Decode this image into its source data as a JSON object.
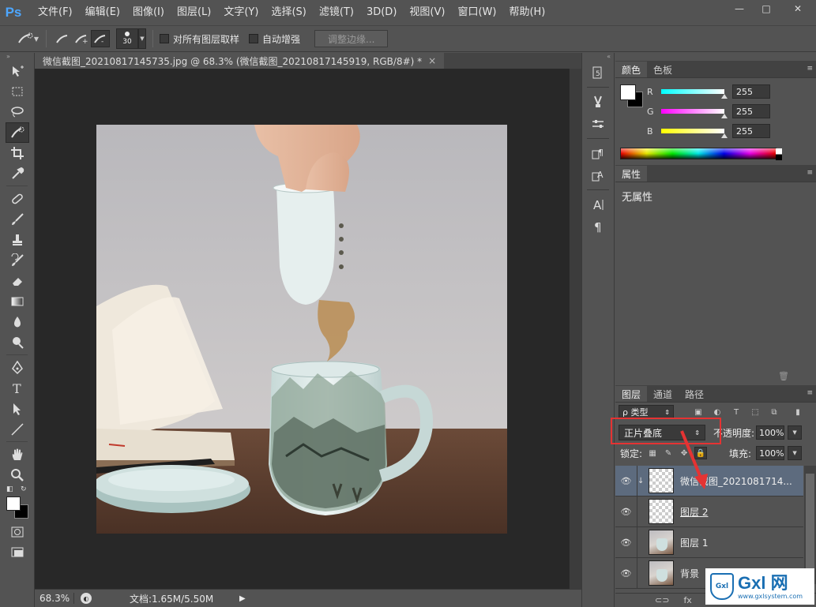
{
  "app": {
    "logo": "Ps"
  },
  "menu": [
    "文件(F)",
    "编辑(E)",
    "图像(I)",
    "图层(L)",
    "文字(Y)",
    "选择(S)",
    "滤镜(T)",
    "3D(D)",
    "视图(V)",
    "窗口(W)",
    "帮助(H)"
  ],
  "window_controls": {
    "minimize": "—",
    "maximize": "□",
    "close": "✕"
  },
  "options": {
    "brush_size": "30",
    "sample_all_layers": "对所有图层取样",
    "auto_enhance": "自动增强",
    "refine_edge": "调整边缘..."
  },
  "document": {
    "tab_title": "微信截图_20210817145735.jpg @ 68.3% (微信截图_20210817145919, RGB/8#) *",
    "close": "×",
    "zoom": "68.3%",
    "doc_info": "文档:1.65M/5.50M"
  },
  "color_panel": {
    "tabs": [
      "颜色",
      "色板"
    ],
    "channels": [
      {
        "label": "R",
        "value": "255",
        "color": "#00ffff"
      },
      {
        "label": "G",
        "value": "255",
        "color": "#ff00ff"
      },
      {
        "label": "B",
        "value": "255",
        "color": "#ffff00"
      }
    ]
  },
  "properties_panel": {
    "tabs": [
      "属性"
    ],
    "text": "无属性"
  },
  "layers_panel": {
    "tabs": [
      "图层",
      "通道",
      "路径"
    ],
    "kind_label": "ρ 类型",
    "blend_mode": "正片叠底",
    "opacity_label": "不透明度:",
    "opacity_value": "100%",
    "lock_label": "锁定:",
    "fill_label": "填充:",
    "fill_value": "100%",
    "layers": [
      {
        "name": "微信截图_2021081714...",
        "selected": true,
        "clipped": true,
        "thumb": "transparent",
        "underline": false
      },
      {
        "name": "图层 2",
        "selected": false,
        "clipped": false,
        "thumb": "transparent",
        "underline": true
      },
      {
        "name": "图层 1",
        "selected": false,
        "clipped": false,
        "thumb": "photo",
        "underline": false
      },
      {
        "name": "背景",
        "selected": false,
        "clipped": false,
        "thumb": "photo",
        "underline": false
      }
    ],
    "fx_label": "fx"
  },
  "watermark": {
    "shield": "Gxl",
    "title": "Gxl 网",
    "url": "www.gxlsystem.com"
  },
  "accent_colors": {
    "highlight": "#e53333",
    "ps_blue": "#4da6ff",
    "selected_layer": "#5d6b7e"
  }
}
